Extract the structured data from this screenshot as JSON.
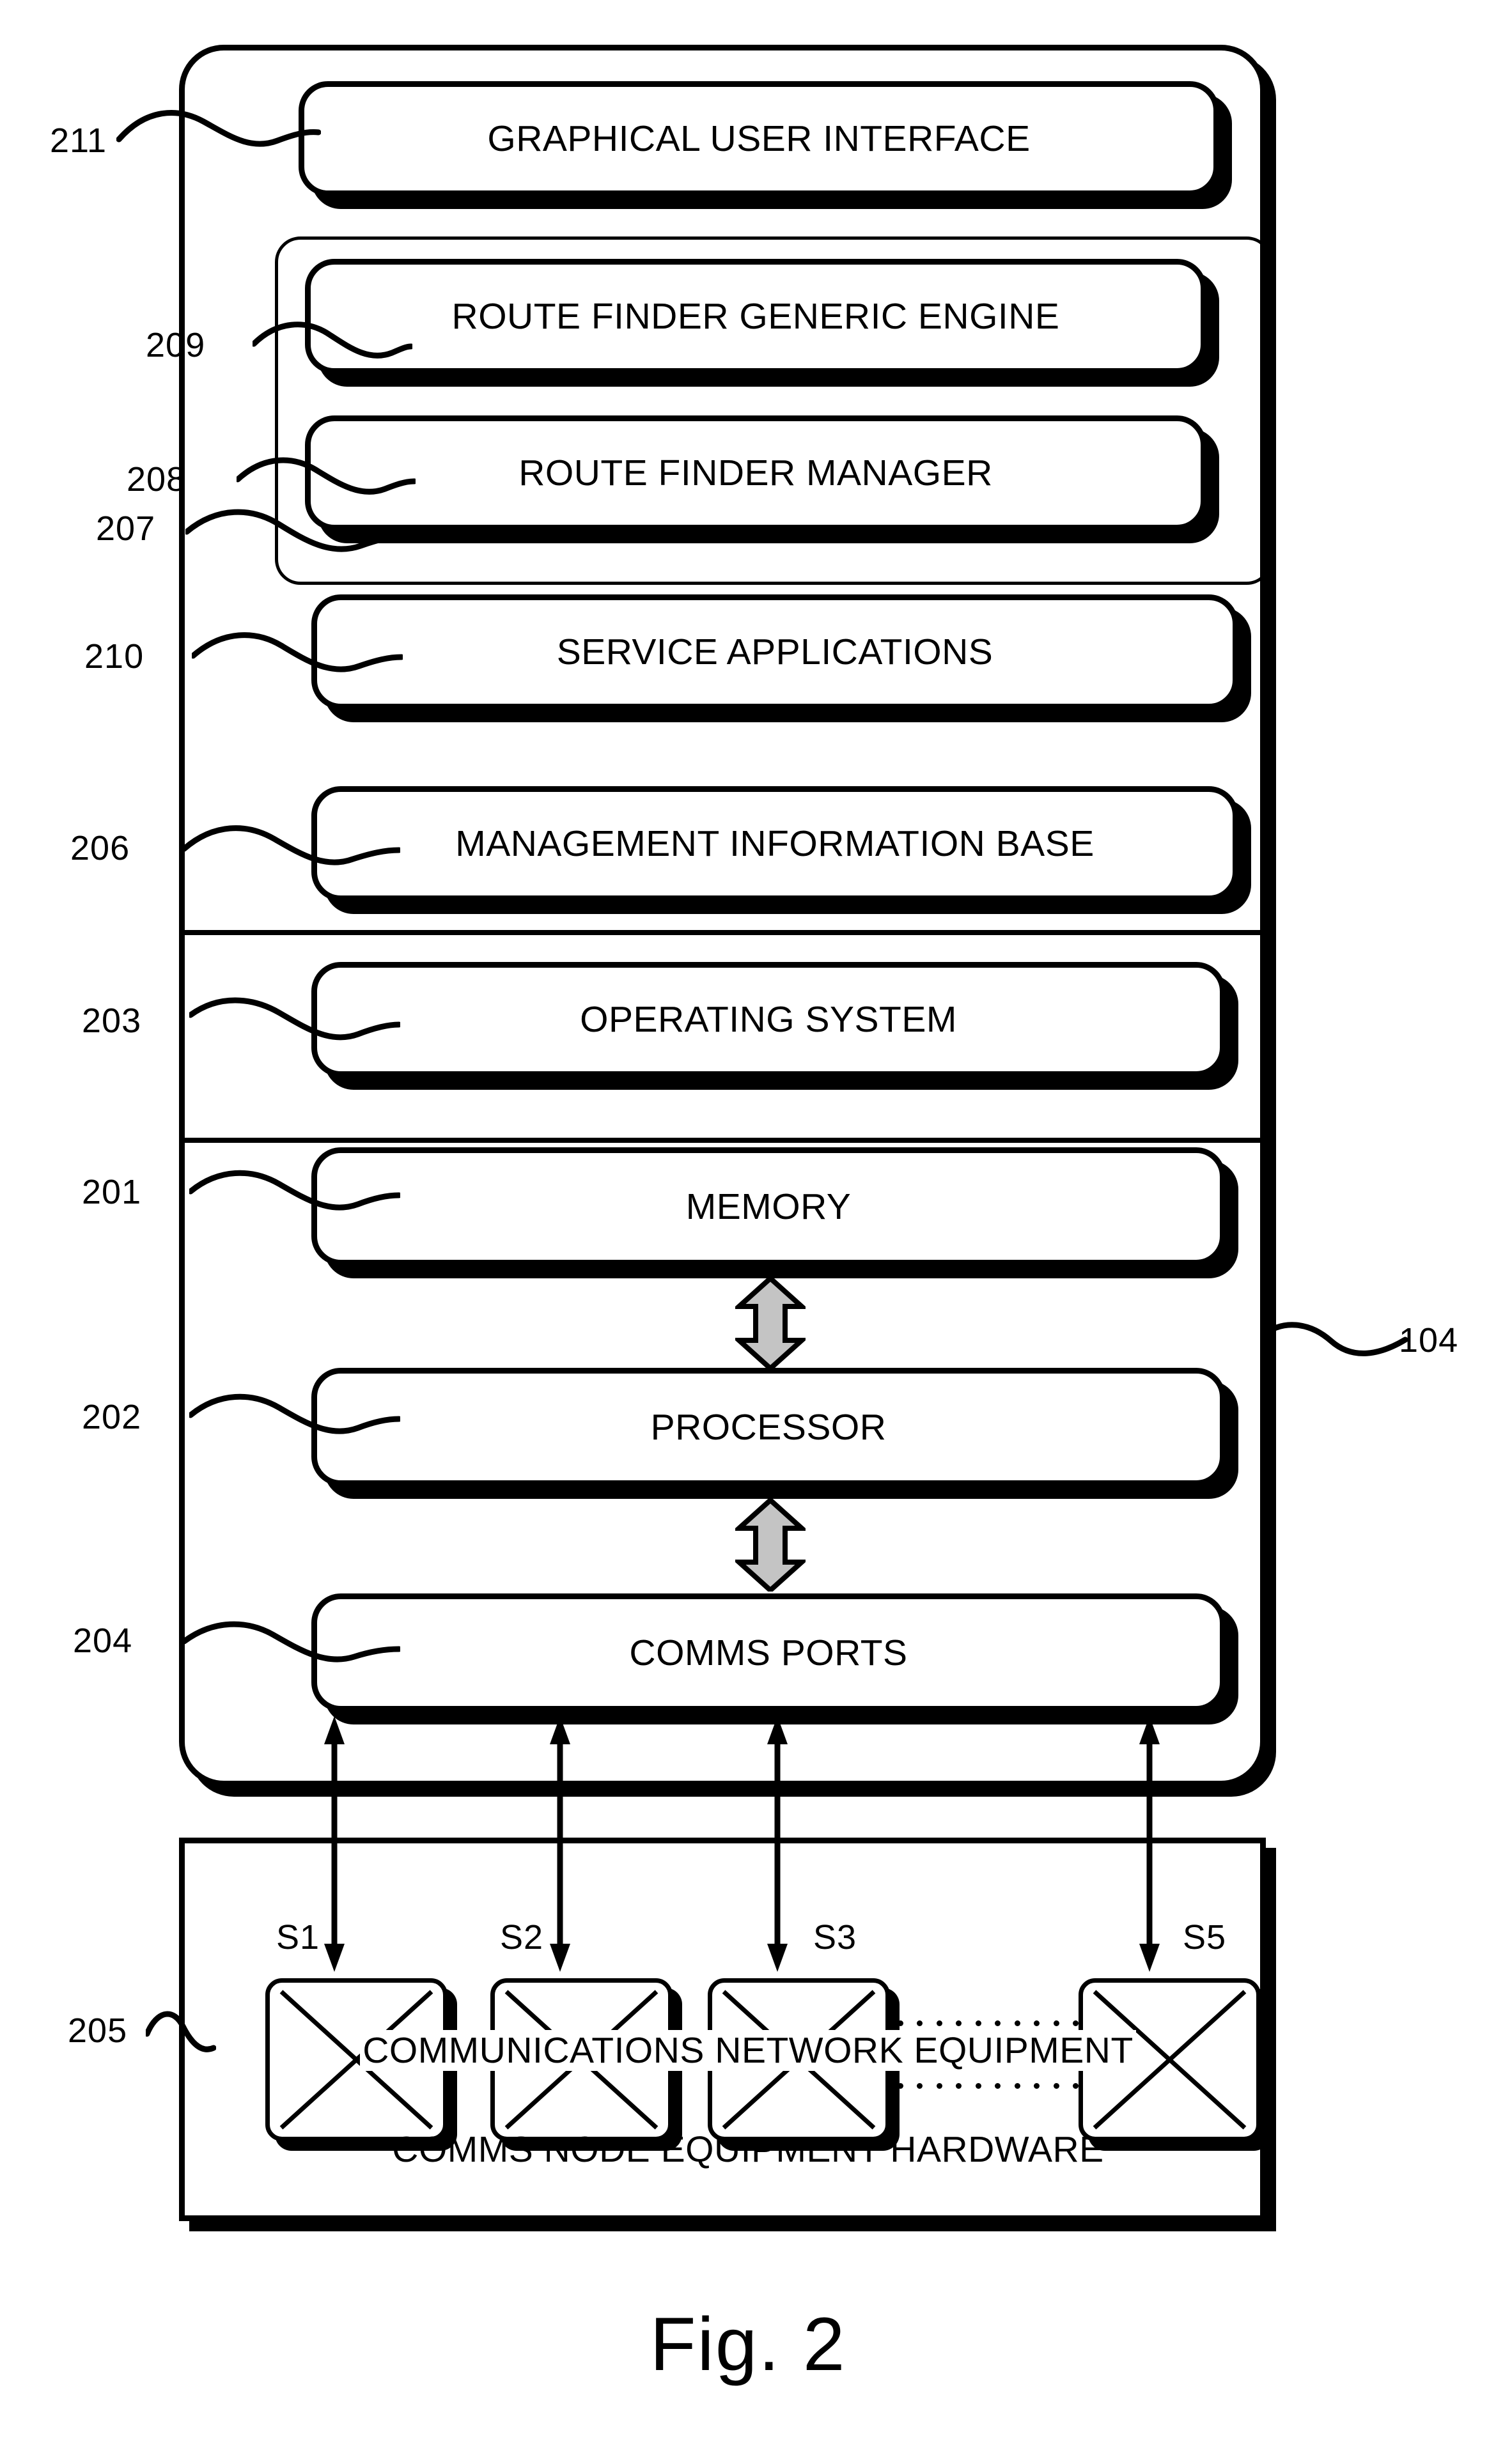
{
  "figure": {
    "caption": "Fig. 2",
    "system_ref": "104"
  },
  "outer_container": {
    "ref": "104"
  },
  "modules": [
    {
      "ref": "211",
      "label": "GRAPHICAL USER INTERFACE"
    },
    {
      "ref": "209",
      "label": "ROUTE FINDER GENERIC ENGINE"
    },
    {
      "ref": "208",
      "label": "ROUTE FINDER MANAGER"
    },
    {
      "ref": "210",
      "label": "SERVICE APPLICATIONS"
    },
    {
      "ref": "206",
      "label": "MANAGEMENT INFORMATION BASE"
    },
    {
      "ref": "203",
      "label": "OPERATING SYSTEM"
    },
    {
      "ref": "201",
      "label": "MEMORY"
    },
    {
      "ref": "202",
      "label": "PROCESSOR"
    },
    {
      "ref": "204",
      "label": "COMMS PORTS"
    }
  ],
  "group_frame": {
    "ref": "207",
    "contains": [
      "ROUTE FINDER GENERIC ENGINE",
      "ROUTE FINDER MANAGER"
    ]
  },
  "hardware": {
    "ref": "205",
    "title": "COMMS NODE EQUIPMENT HARDWARE",
    "network_label": "COMMUNICATIONS NETWORK EQUIPMENT",
    "switches": [
      {
        "tag": "S1"
      },
      {
        "tag": "S2"
      },
      {
        "tag": "S3"
      },
      {
        "tag": "S5"
      }
    ],
    "continuation": "dotted-ellipsis"
  },
  "refs": {
    "r211": "211",
    "r209": "209",
    "r208": "208",
    "r207": "207",
    "r210": "210",
    "r206": "206",
    "r203": "203",
    "r201": "201",
    "r202": "202",
    "r204": "204",
    "r205": "205",
    "r104": "104"
  },
  "colors": {
    "ink": "#000000",
    "paper": "#ffffff",
    "arrow_fill": "#bfbfbf"
  }
}
